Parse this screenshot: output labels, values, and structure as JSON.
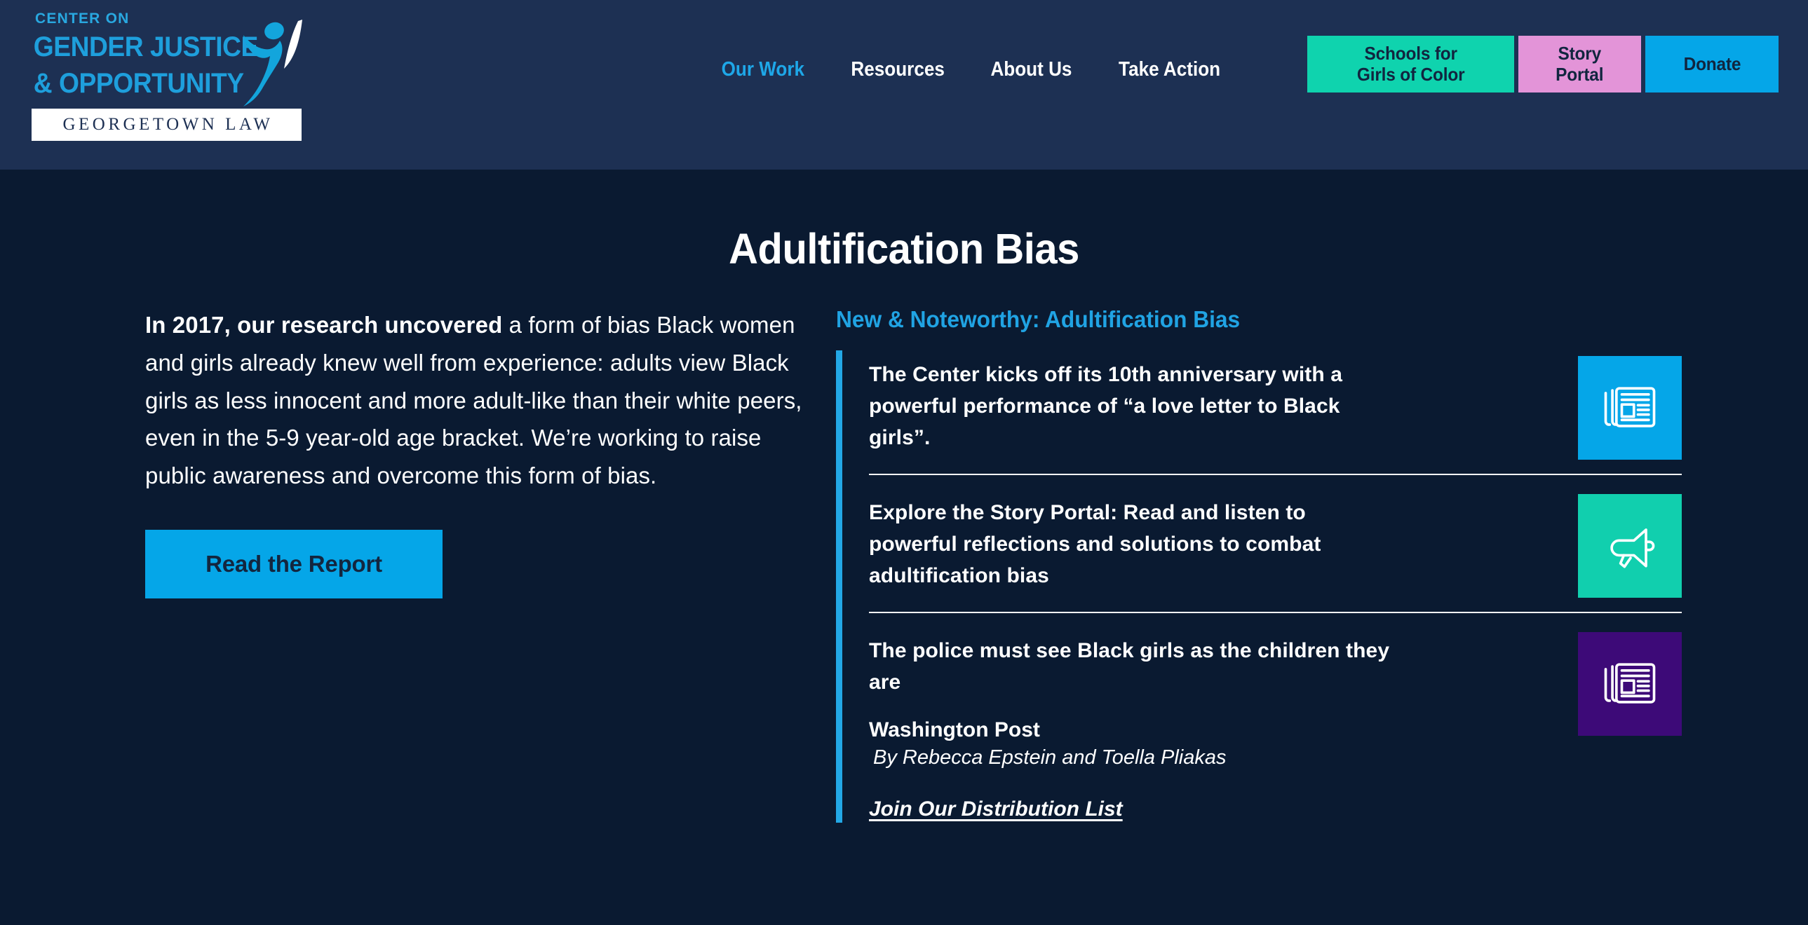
{
  "header": {
    "logo": {
      "eyebrow": "CENTER ON",
      "line1": "GENDER JUSTICE",
      "line2": "& OPPORTUNITY",
      "affiliation": "GEORGETOWN LAW",
      "figure_icon": "person-reaching-icon"
    },
    "nav": [
      {
        "label": "Our Work",
        "active": true
      },
      {
        "label": "Resources",
        "active": false
      },
      {
        "label": "About Us",
        "active": false
      },
      {
        "label": "Take Action",
        "active": false
      }
    ],
    "buttons": [
      {
        "label": "Schools for\nGirls of Color",
        "color": "#0fd3ae"
      },
      {
        "label": "Story\nPortal",
        "color": "#e394d8"
      },
      {
        "label": "Donate",
        "color": "#05a6e8"
      }
    ]
  },
  "main": {
    "title": "Adultification Bias",
    "lead_bold": "In 2017, our research uncovered",
    "lead_rest": " a form of bias Black women and girls already knew well from experience: adults view Black girls as less innocent and more adult-like than their white peers, even in the 5-9 year-old age bracket. We’re working to raise public awareness and overcome this form of bias.",
    "report_button": "Read the Report"
  },
  "noteworthy": {
    "title": "New & Noteworthy: Adultification Bias",
    "items": [
      {
        "headline": "The Center kicks off its 10th anniversary with a powerful performance of “a love letter to Black girls”.",
        "source": "",
        "byline": "",
        "icon": "newspaper-icon",
        "icon_color": "#05a6e8"
      },
      {
        "headline": "Explore the Story Portal: Read and listen to powerful reflections and solutions to combat adultification bias",
        "source": "",
        "byline": "",
        "icon": "megaphone-icon",
        "icon_color": "#11cfae"
      },
      {
        "headline": "The police must see Black girls as the children they are",
        "source": "Washington Post",
        "byline": "By Rebecca Epstein and Toella Pliakas",
        "icon": "newspaper-icon",
        "icon_color": "#3d0a78"
      }
    ],
    "distribution_link": "Join Our Distribution List"
  },
  "colors": {
    "header_bg": "#1d3053",
    "page_bg": "#0a1a31",
    "accent_blue": "#23a8e6",
    "link_blue": "#20a3e3",
    "teal": "#0fd3ae",
    "pink": "#e394d8",
    "purple": "#3d0a78"
  }
}
